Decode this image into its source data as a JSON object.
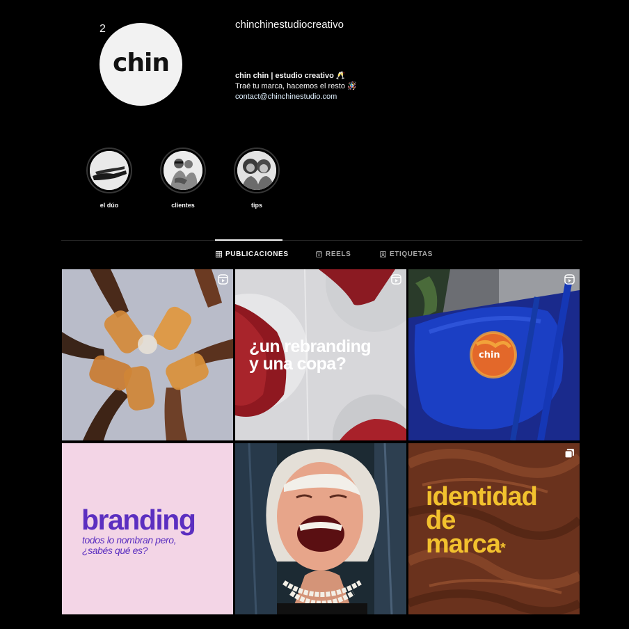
{
  "profile": {
    "username": "chinchinestudiocreativo",
    "avatar_text": "chin",
    "avatar_sup": "2",
    "bio_name": "chin chin | estudio creativo 🥂",
    "bio_line": "Traé tu marca, hacemos el resto 🪅",
    "bio_email": "contact@chinchinestudio.com"
  },
  "highlights": [
    {
      "label": "el dúo"
    },
    {
      "label": "clientes"
    },
    {
      "label": "tips"
    }
  ],
  "tabs": {
    "posts": "PUBLICACIONES",
    "reels": "REELS",
    "tagged": "ETIQUETAS"
  },
  "posts": {
    "p2_line1": "¿un rebranding",
    "p2_line2": "y una copa?",
    "p3_logo": "chin",
    "p4_title": "branding",
    "p4_sub1": "todos lo nombran pero,",
    "p4_sub2": "¿sabés qué es?",
    "p6_line1": "identidad",
    "p6_line2": "de",
    "p6_line3": "marca",
    "p6_asterisk": "*"
  },
  "colors": {
    "background": "#000000",
    "branding_purple": "#5b2fc0",
    "branding_pink": "#f3d5e6",
    "identidad_yellow": "#f2c12e",
    "chocolate": "#6a321d",
    "chair_blue": "#1b3fc4"
  },
  "icons": [
    "grid-icon",
    "reels-icon",
    "tagged-icon",
    "reel-badge-icon",
    "carousel-badge-icon"
  ]
}
